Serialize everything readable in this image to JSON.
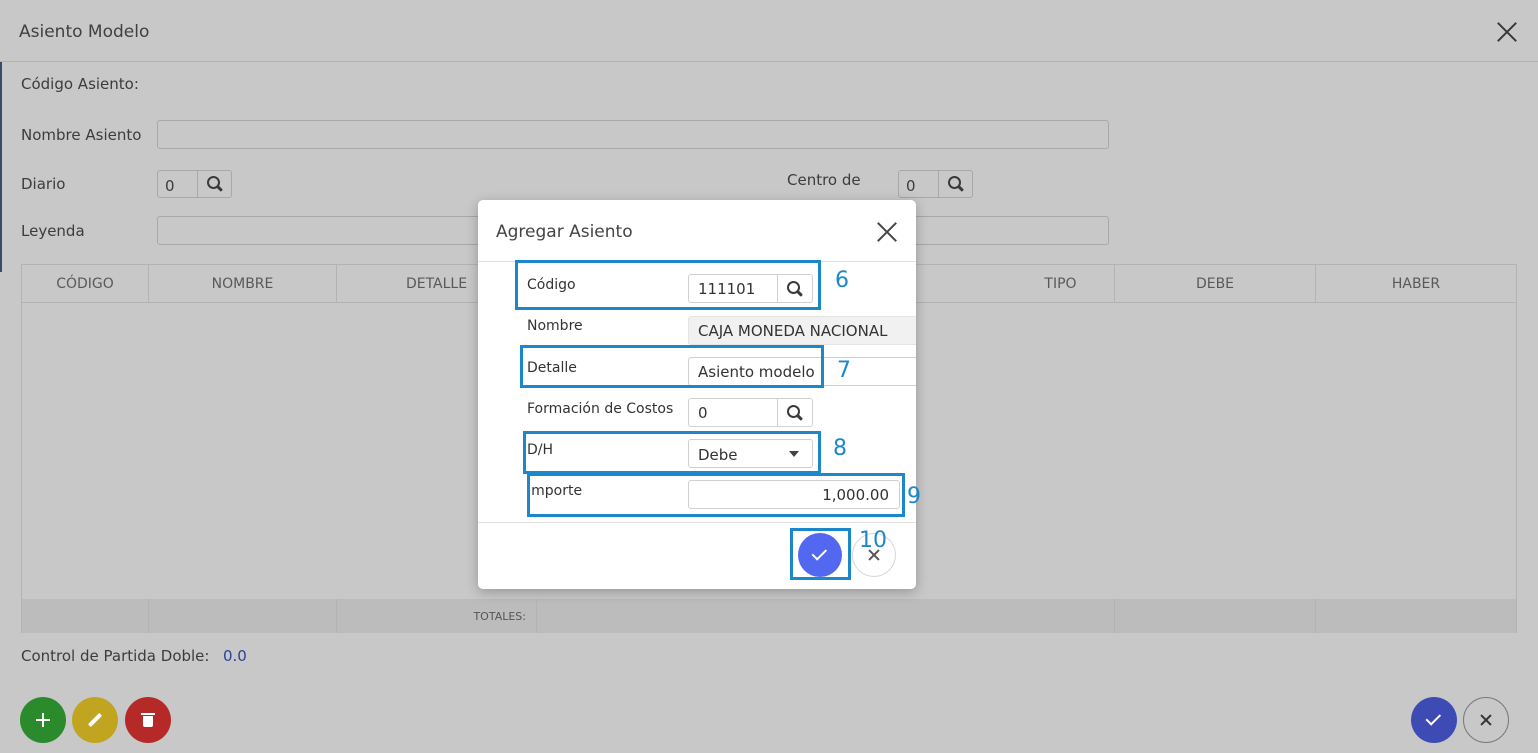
{
  "page": {
    "title": "Asiento Modelo",
    "codigo_asiento_label": "Código Asiento:",
    "nombre_asiento_label": "Nombre Asiento",
    "diario_label": "Diario",
    "diario_value": "0",
    "centro_label": "Centro de",
    "centro_value": "0",
    "leyenda_label": "Leyenda",
    "columns": [
      "CÓDIGO",
      "NOMBRE",
      "DETALLE",
      "TIPO",
      "DEBE",
      "HABER"
    ],
    "totales_label": "TOTALES:",
    "control_label": "Control de Partida Doble:",
    "control_value": "0.0"
  },
  "modal": {
    "title": "Agregar Asiento",
    "codigo_label": "Código",
    "codigo_value": "111101",
    "nombre_label": "Nombre",
    "nombre_value": "CAJA MONEDA NACIONAL",
    "detalle_label": "Detalle",
    "detalle_value": "Asiento modelo",
    "formacion_label": "Formación de Costos",
    "formacion_value": "0",
    "dh_label": "D/H",
    "dh_value": "Debe",
    "importe_label": "Importe",
    "importe_value": "1,000.00"
  },
  "annotations": [
    "6",
    "7",
    "8",
    "9",
    "10"
  ],
  "colors": {
    "accent": "#5368f0",
    "annotation": "#1d88c9",
    "add": "#2b8a2b",
    "edit": "#c1a520",
    "delete": "#b62929"
  }
}
